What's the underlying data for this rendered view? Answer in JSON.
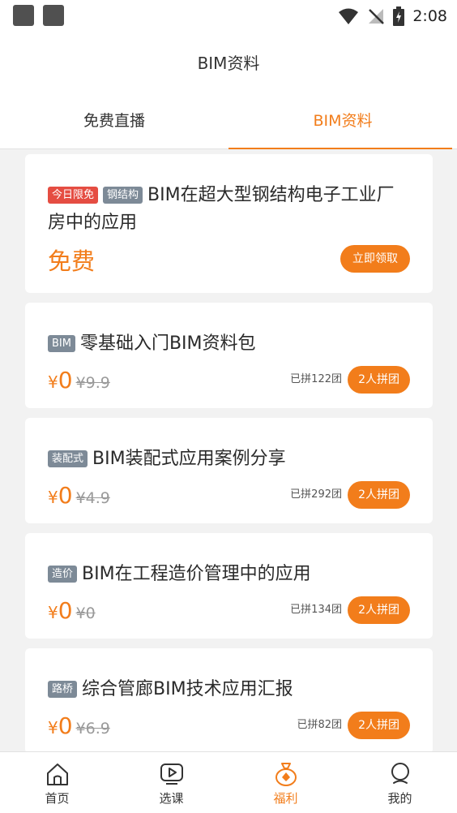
{
  "status_bar": {
    "time": "2:08"
  },
  "header": {
    "title": "BIM资料"
  },
  "tabs": [
    {
      "label": "免费直播",
      "active": false
    },
    {
      "label": "BIM资料",
      "active": true
    }
  ],
  "featured": {
    "tags": [
      "今日限免",
      "钢结构"
    ],
    "title": "BIM在超大型钢结构电子工业厂房中的应用",
    "price_label": "免费",
    "action_label": "立即领取"
  },
  "items": [
    {
      "tag": "BIM",
      "title": "零基础入门BIM资料包",
      "currency": "¥",
      "price": "0",
      "original_price": "¥9.9",
      "group_count": "已拼122团",
      "group_button": "2人拼团"
    },
    {
      "tag": "装配式",
      "title": "BIM装配式应用案例分享",
      "currency": "¥",
      "price": "0",
      "original_price": "¥4.9",
      "group_count": "已拼292团",
      "group_button": "2人拼团"
    },
    {
      "tag": "造价",
      "title": "BIM在工程造价管理中的应用",
      "currency": "¥",
      "price": "0",
      "original_price": "¥0",
      "group_count": "已拼134团",
      "group_button": "2人拼团"
    },
    {
      "tag": "路桥",
      "title": "综合管廊BIM技术应用汇报",
      "currency": "¥",
      "price": "0",
      "original_price": "¥6.9",
      "group_count": "已拼82团",
      "group_button": "2人拼团"
    }
  ],
  "bottom_nav": [
    {
      "label": "首页",
      "icon": "home-icon",
      "active": false
    },
    {
      "label": "选课",
      "icon": "video-play-icon",
      "active": false
    },
    {
      "label": "福利",
      "icon": "money-bag-icon",
      "active": true
    },
    {
      "label": "我的",
      "icon": "user-icon",
      "active": false
    }
  ],
  "colors": {
    "accent": "#f27d1b",
    "tag_red": "#e54d42",
    "tag_gray": "#7d8a97",
    "list_bg": "#f2f2f2"
  }
}
